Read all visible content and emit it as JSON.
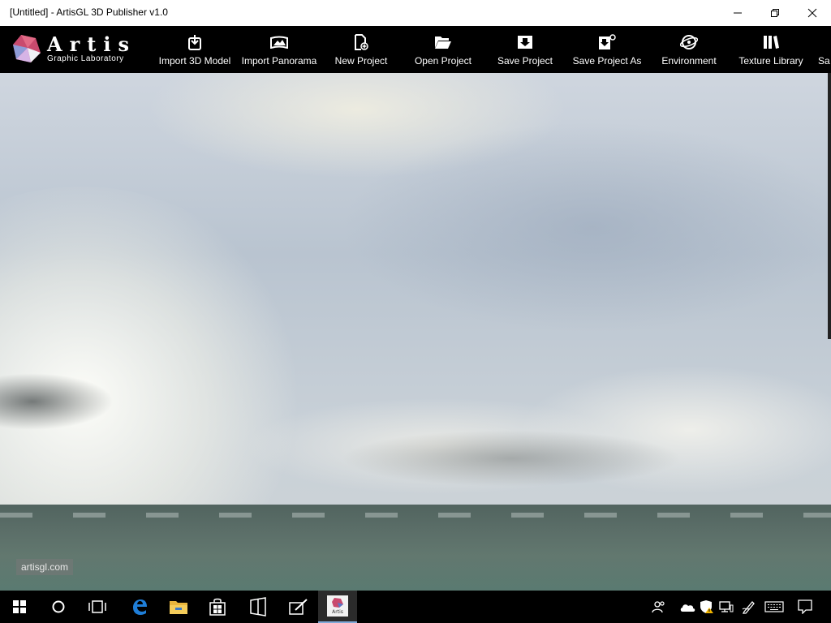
{
  "window": {
    "title": "[Untitled] - ArtisGL 3D Publisher v1.0"
  },
  "logo": {
    "word": "Artis",
    "subtitle": "Graphic Laboratory"
  },
  "toolbar": {
    "items": [
      {
        "label": "Import 3D Model",
        "icon": "import-model-icon"
      },
      {
        "label": "Import Panorama",
        "icon": "panorama-icon"
      },
      {
        "label": "New Project",
        "icon": "new-project-icon"
      },
      {
        "label": "Open Project",
        "icon": "folder-open-icon"
      },
      {
        "label": "Save Project",
        "icon": "save-icon"
      },
      {
        "label": "Save Project As",
        "icon": "save-as-icon"
      },
      {
        "label": "Environment",
        "icon": "environment-icon"
      },
      {
        "label": "Texture Library",
        "icon": "texture-library-icon"
      },
      {
        "label": "Sa",
        "icon": ""
      }
    ]
  },
  "viewport": {
    "watermark": "artisgl.com"
  },
  "taskbar": {
    "apps": [
      "start",
      "cortana",
      "task-view",
      "edge",
      "file-explorer",
      "store",
      "phone",
      "notes",
      "artis"
    ],
    "artis_icon_text": "Artis"
  },
  "colors": {
    "toolbar_bg": "#000000",
    "titlebar_bg": "#ffffff",
    "taskbar_active_underline": "#7fa9d8"
  }
}
